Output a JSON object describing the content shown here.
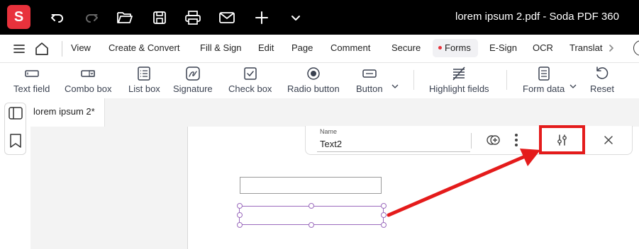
{
  "app": {
    "logo_letter": "S",
    "document_title": "lorem ipsum 2.pdf  -  Soda PDF 360",
    "brand_color": "#e8323c"
  },
  "titlebar_icons": [
    "undo-icon",
    "redo-icon",
    "open-folder-icon",
    "save-icon",
    "print-icon",
    "email-icon",
    "add-icon",
    "chevron-down-icon"
  ],
  "menu": {
    "items": [
      "View",
      "Create & Convert",
      "Fill & Sign",
      "Edit",
      "Page",
      "Comment",
      "Secure",
      "Forms",
      "E-Sign",
      "OCR",
      "Translat"
    ],
    "active": "Forms"
  },
  "toolbar": {
    "tools": [
      "Text field",
      "Combo box",
      "List box",
      "Signature",
      "Check box",
      "Radio button",
      "Button",
      "Highlight fields",
      "Form data",
      "Reset"
    ]
  },
  "document_tab": "lorem ipsum 2*",
  "field_properties": {
    "name_label": "Name",
    "name_value": "Text2"
  },
  "annotation": {
    "color": "#e41b1b"
  }
}
